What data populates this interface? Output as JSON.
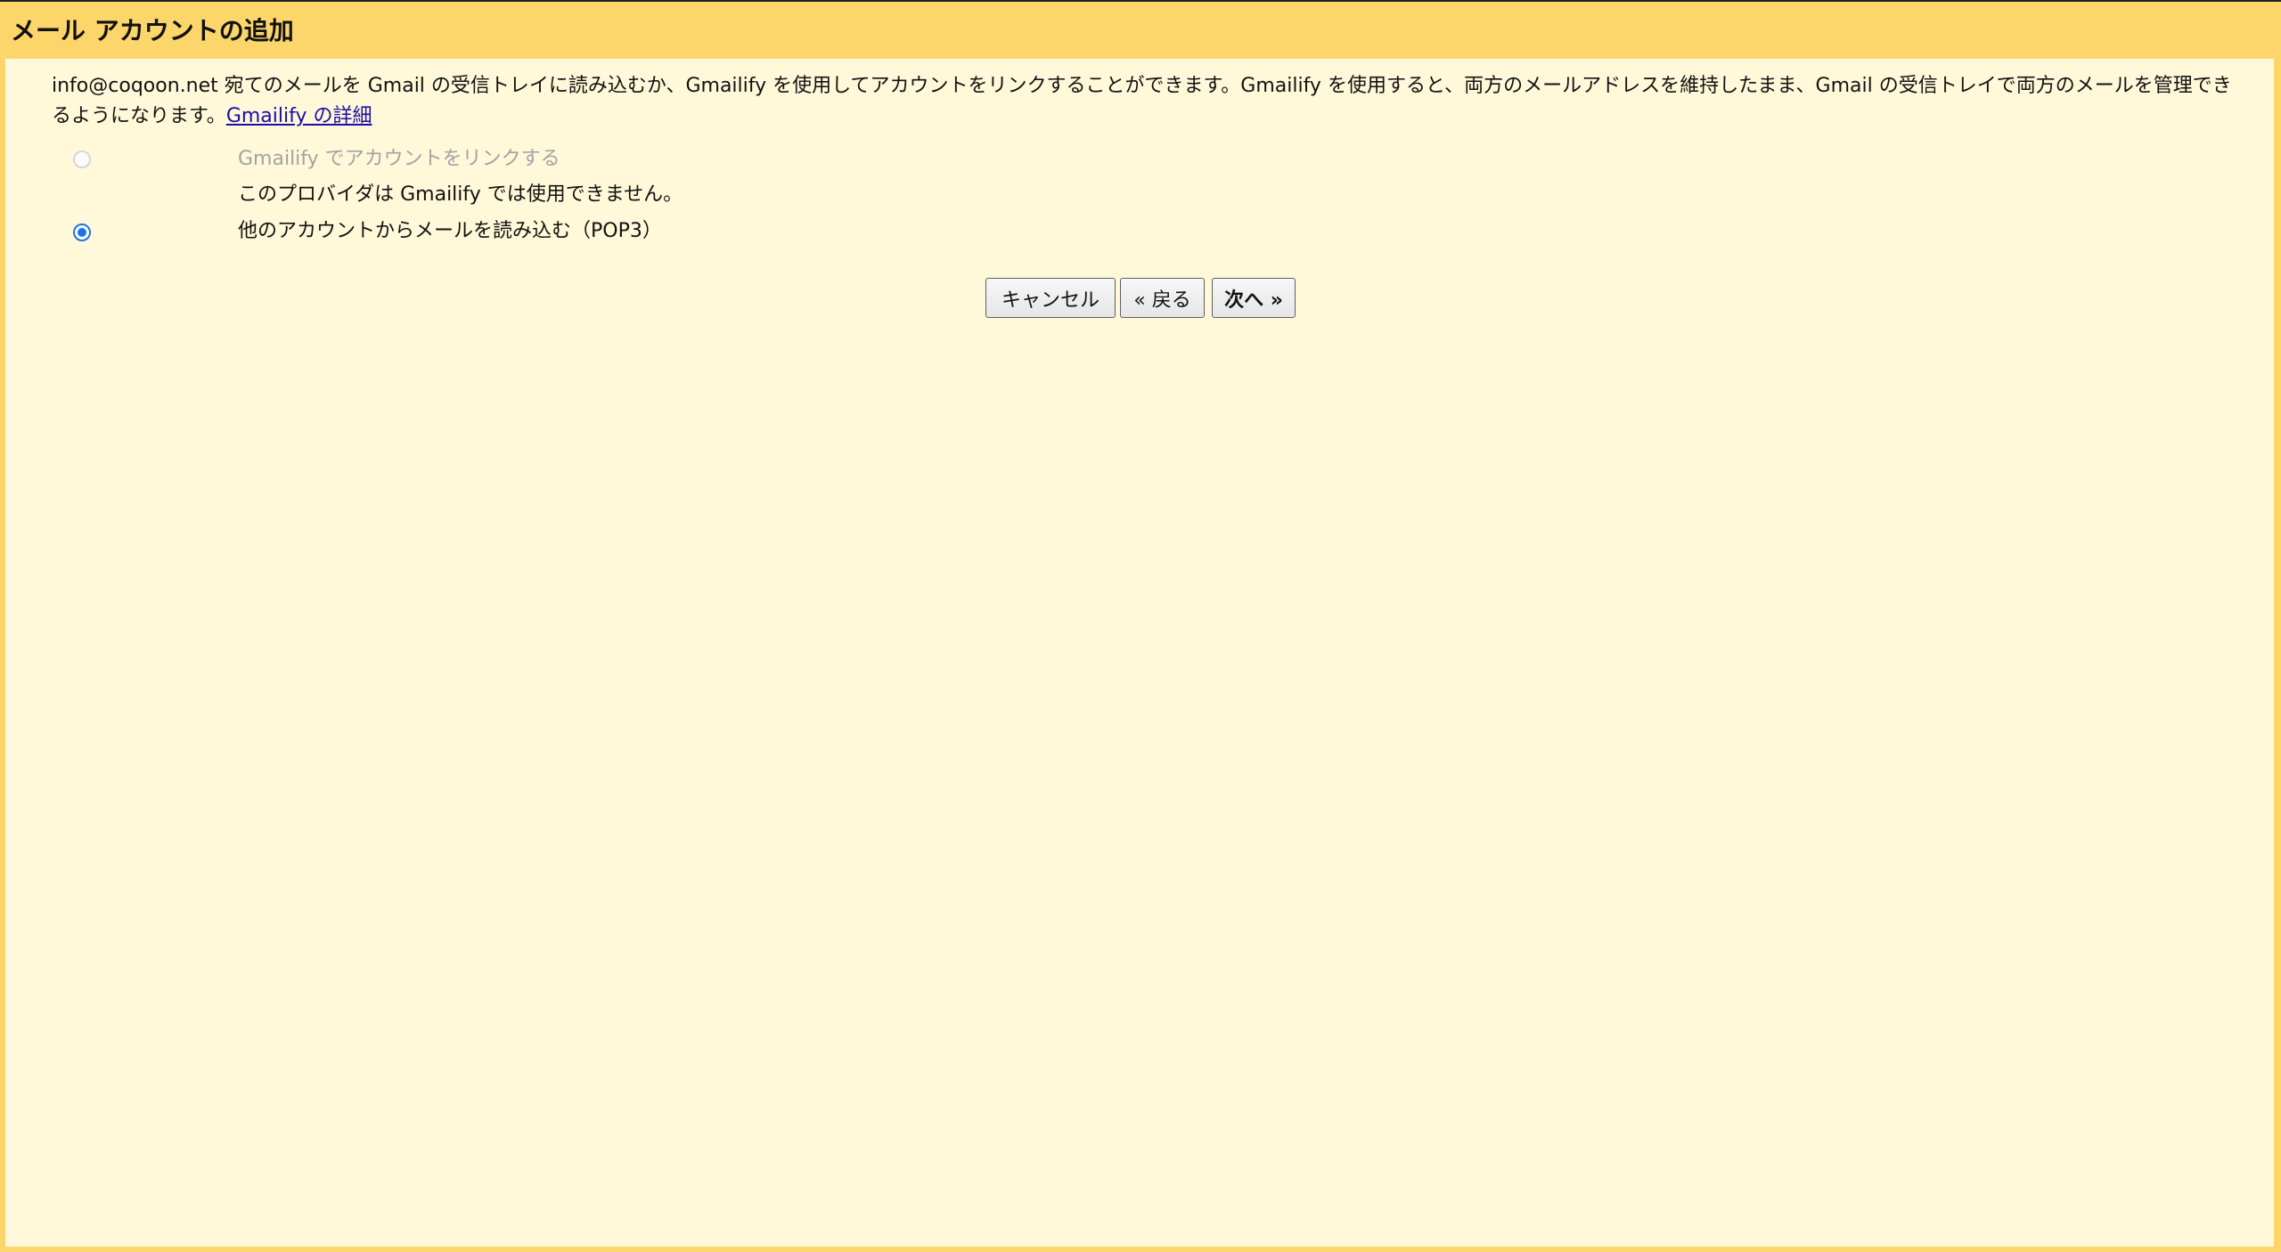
{
  "dialog": {
    "title": "メール アカウントの追加"
  },
  "intro": {
    "text": "info@coqoon.net 宛てのメールを Gmail の受信トレイに読み込むか、Gmailify を使用してアカウントをリンクすることができます。Gmailify を使用すると、両方のメールアドレスを維持したまま、Gmail の受信トレイで両方のメールを管理できるようになります。",
    "link_label": "Gmailify の詳細"
  },
  "options": {
    "gmailify": {
      "label": "Gmailify でアカウントをリンクする",
      "note": "このプロバイダは Gmailify では使用できません。",
      "selected": false,
      "disabled": true
    },
    "pop3": {
      "label": "他のアカウントからメールを読み込む（POP3）",
      "selected": true,
      "disabled": false
    }
  },
  "buttons": {
    "cancel": "キャンセル",
    "back": "« 戻る",
    "next": "次へ »"
  },
  "colors": {
    "header_bg": "#fdd66b",
    "content_bg": "#fff8d9",
    "link": "#1a0dab",
    "radio_selected": "#1a73e8",
    "disabled_text": "#a3a3a3"
  }
}
